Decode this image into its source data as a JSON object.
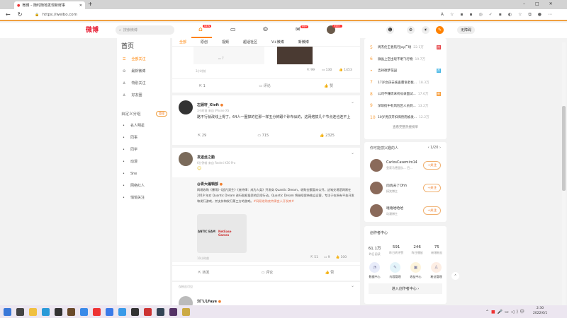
{
  "browser": {
    "tab_title": "微博 – 随时随地发现新鲜事",
    "url": "https://weibo.com"
  },
  "header": {
    "logo": "微博",
    "search_placeholder": "搜索微博",
    "home_badge": "NEW",
    "msg_badge": "99+",
    "avatar_badge": "999+",
    "accessibility": "无障碍"
  },
  "sidebar": {
    "title": "首页",
    "items": [
      {
        "label": "全部关注",
        "icon": "list-icon"
      },
      {
        "label": "最新微博",
        "icon": "clock-icon"
      },
      {
        "label": "特别关注",
        "icon": "user-icon"
      },
      {
        "label": "好友圈",
        "icon": "friends-icon"
      }
    ],
    "groups_title": "自定义分组",
    "manage": "管理",
    "groups": [
      "名人明星",
      "同事",
      "同学",
      "动漫",
      "She",
      "网络红人",
      "悄悄关注"
    ]
  },
  "feed": {
    "tabs": [
      "全部",
      "原创",
      "视频",
      "超话社区",
      "V+微博",
      "新微博"
    ],
    "post0": {
      "comment_count_inner": "7",
      "time": "3小时前",
      "repost": "99",
      "comments": "130",
      "likes": "1453",
      "act_repost": "1",
      "act_comment": "评论",
      "act_like": "赞"
    },
    "post1": {
      "user": "左顾轩_Xleft",
      "meta": "3小时前  来自 iPhone XS",
      "text": "路不行就改线上得了。64人一圈掉的往那一样五分钟跟个砂布似的，这网络搞几个节点连也连不上",
      "repost": "29",
      "comments": "715",
      "likes": "2325"
    },
    "post2": {
      "user": "发迹丝之勤",
      "meta": "6分钟前  来自 Redmi K50 Pro",
      "quote_user": "@青大编辑部",
      "quote_text": "网易收购《暴雨》《超凡双生》《底特律：成为人类》开发商 Quantic Dream。收购金额暂未公开。这笔交易是网易在 2019 年对 Quantic Dream 进行股权投资的后续行动。Quantic Dream 将继续保持独立运营，专注于在所有平台开发和发行游戏，并支持和发行第三方的游戏。",
      "quote_tag": "#网易收购底特律变人开发商#",
      "image_text_left": "ANTIC EAM",
      "image_text_right": "NetEase Games",
      "time": "10小时前",
      "repost": "51",
      "comments": "9",
      "likes": "100",
      "act_repost": "转发",
      "act_comment": "评论",
      "act_like": "赞"
    },
    "post3": {
      "visibility": "仅粉丝可见",
      "user": "刘飞儿Faye"
    }
  },
  "hot": {
    "items": [
      {
        "rank": "5",
        "title": "周杰伦王者航行Jay广场",
        "count": "22.1万",
        "tag": "热"
      },
      {
        "rank": "6",
        "title": "微晶上空出现不明飞行物",
        "count": "19.7万",
        "tag": ""
      },
      {
        "rank": "•",
        "title": "吉祥德梦花园",
        "count": "",
        "tag": "荐"
      },
      {
        "rank": "7",
        "title": "17岁女孩去核查遭语老板...",
        "count": "18.3万",
        "tag": ""
      },
      {
        "rank": "8",
        "title": "公司不赚周末机号录面试...",
        "count": "17.6万",
        "tag": "新"
      },
      {
        "rank": "9",
        "title": "深圳街中有风险区人员到...",
        "count": "13.2万",
        "tag": ""
      },
      {
        "rank": "10",
        "title": "10岁男孩开扣嗨然而被发...",
        "count": "12.2万",
        "tag": ""
      }
    ],
    "more": "查看完整热搜榜单"
  },
  "suggest": {
    "title": "你可能感兴趣的人",
    "page": "1/20",
    "follow": "+关注",
    "people": [
      {
        "name": "CarlosCasemiro14",
        "desc": "皇家马德里队... 巴..."
      },
      {
        "name": "肉肉去了Ohh",
        "desc": "搞笑博主"
      },
      {
        "name": "嘻嘻哈哈哈",
        "desc": "动漫博主"
      }
    ]
  },
  "creator": {
    "title": "创作者中心",
    "stats": [
      {
        "value": "61.1万",
        "label": "昨日阅读"
      },
      {
        "value": "591",
        "label": "昨日转评赞"
      },
      {
        "value": "246",
        "label": "昨日播放"
      },
      {
        "value": "75",
        "label": "新增粉丝"
      }
    ],
    "tools": [
      "数据中心",
      "内容管理",
      "收益中心",
      "粉丝管理"
    ],
    "enter": "进入创作者中心"
  },
  "taskbar": {
    "time": "2:30",
    "date": "2022/6/1"
  },
  "colors": {
    "accent": "#ff8200",
    "link": "#eb7350"
  }
}
